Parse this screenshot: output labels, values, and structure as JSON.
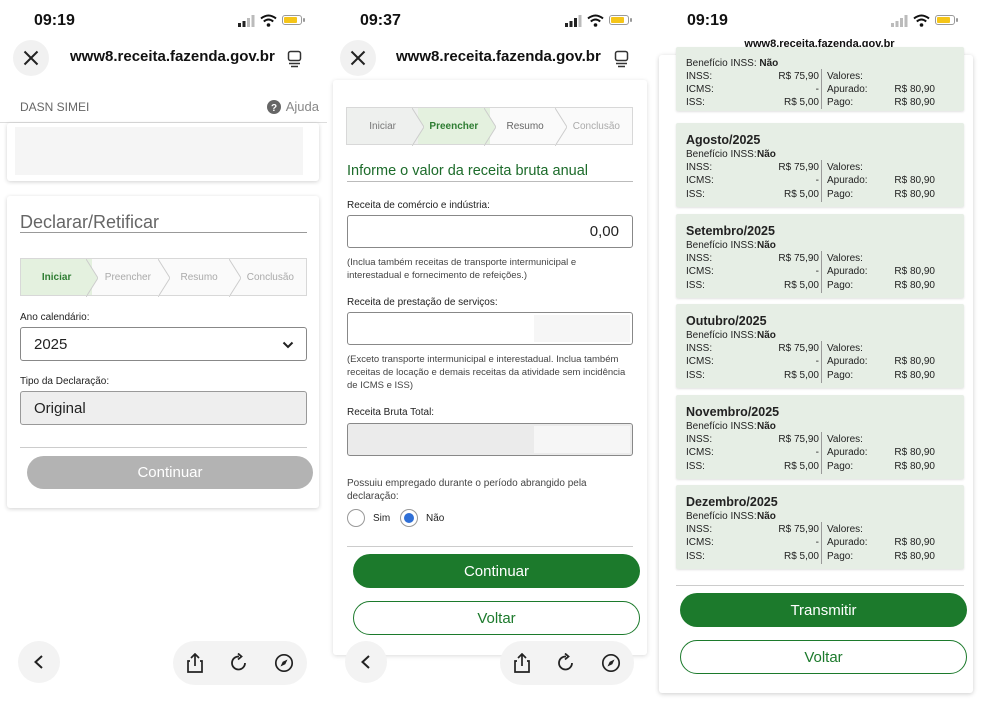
{
  "panel1": {
    "time": "09:19",
    "url": "www8.receita.fazenda.gov.br",
    "app_name": "DASN SIMEI",
    "help": "Ajuda",
    "title": "Declarar/Retificar",
    "steps": [
      "Iniciar",
      "Preencher",
      "Resumo",
      "Conclusão"
    ],
    "year_label": "Ano calendário:",
    "year_value": "2025",
    "type_label": "Tipo da Declaração:",
    "type_value": "Original",
    "continue": "Continuar"
  },
  "panel2": {
    "time": "09:37",
    "url": "www8.receita.fazenda.gov.br",
    "steps": [
      "Iniciar",
      "Preencher",
      "Resumo",
      "Conclusão"
    ],
    "heading": "Informe o valor da receita bruta anual",
    "commerce_label": "Receita de comércio e indústria:",
    "commerce_value": "0,00",
    "commerce_hint": "(Inclua também receitas de transporte intermunicipal e interestadual e fornecimento de refeições.)",
    "services_label": "Receita de prestação de serviços:",
    "services_value": "",
    "services_hint": "(Exceto transporte intermunicipal e interestadual. Inclua também receitas de locação e demais receitas da atividade sem incidência de ICMS e ISS)",
    "total_label": "Receita Bruta Total:",
    "employee_question": "Possuiu empregado durante o período abrangido pela declaração:",
    "option_yes": "Sim",
    "option_no": "Não",
    "selected_option": "Não",
    "continue": "Continuar",
    "back": "Voltar"
  },
  "panel3": {
    "time": "09:19",
    "url": "www8.receita.fazenda.gov.br",
    "partial": {
      "benefit_label": "Benefício INSS:",
      "benefit_value": "Não",
      "inss_label": "INSS:",
      "inss_value": "R$ 75,90",
      "icms_label": "ICMS:",
      "icms_value": "-",
      "iss_label": "ISS:",
      "iss_value": "R$ 5,00",
      "valores_label": "Valores:",
      "apurado_label": "Apurado:",
      "apurado_value": "R$ 80,90",
      "pago_label": "Pago:",
      "pago_value": "R$ 80,90"
    },
    "months": [
      {
        "month": "Agosto/2025",
        "benefit_label": "Benefício INSS:",
        "benefit_value": "Não",
        "inss_label": "INSS:",
        "inss_value": "R$ 75,90",
        "icms_label": "ICMS:",
        "icms_value": "-",
        "iss_label": "ISS:",
        "iss_value": "R$ 5,00",
        "valores_label": "Valores:",
        "apurado_label": "Apurado:",
        "apurado_value": "R$ 80,90",
        "pago_label": "Pago:",
        "pago_value": "R$ 80,90"
      },
      {
        "month": "Setembro/2025",
        "benefit_label": "Benefício INSS:",
        "benefit_value": "Não",
        "inss_label": "INSS:",
        "inss_value": "R$ 75,90",
        "icms_label": "ICMS:",
        "icms_value": "-",
        "iss_label": "ISS:",
        "iss_value": "R$ 5,00",
        "valores_label": "Valores:",
        "apurado_label": "Apurado:",
        "apurado_value": "R$ 80,90",
        "pago_label": "Pago:",
        "pago_value": "R$ 80,90"
      },
      {
        "month": "Outubro/2025",
        "benefit_label": "Benefício INSS:",
        "benefit_value": "Não",
        "inss_label": "INSS:",
        "inss_value": "R$ 75,90",
        "icms_label": "ICMS:",
        "icms_value": "-",
        "iss_label": "ISS:",
        "iss_value": "R$ 5,00",
        "valores_label": "Valores:",
        "apurado_label": "Apurado:",
        "apurado_value": "R$ 80,90",
        "pago_label": "Pago:",
        "pago_value": "R$ 80,90"
      },
      {
        "month": "Novembro/2025",
        "benefit_label": "Benefício INSS:",
        "benefit_value": "Não",
        "inss_label": "INSS:",
        "inss_value": "R$ 75,90",
        "icms_label": "ICMS:",
        "icms_value": "-",
        "iss_label": "ISS:",
        "iss_value": "R$ 5,00",
        "valores_label": "Valores:",
        "apurado_label": "Apurado:",
        "apurado_value": "R$ 80,90",
        "pago_label": "Pago:",
        "pago_value": "R$ 80,90"
      },
      {
        "month": "Dezembro/2025",
        "benefit_label": "Benefício INSS:",
        "benefit_value": "Não",
        "inss_label": "INSS:",
        "inss_value": "R$ 75,90",
        "icms_label": "ICMS:",
        "icms_value": "-",
        "iss_label": "ISS:",
        "iss_value": "R$ 5,00",
        "valores_label": "Valores:",
        "apurado_label": "Apurado:",
        "apurado_value": "R$ 80,90",
        "pago_label": "Pago:",
        "pago_value": "R$ 80,90"
      }
    ],
    "transmit": "Transmitir",
    "back": "Voltar"
  },
  "colors": {
    "primary_green": "#1c7a2c",
    "step_active_bg": "#e4f1df",
    "month_card_bg": "#e6eee5",
    "radio_selected": "#2f6fd6",
    "battery": "#f5c518"
  },
  "icons": [
    "close-icon",
    "tabs-icon",
    "help-icon",
    "chevron-down-icon",
    "back-arrow-icon",
    "share-icon",
    "reload-icon",
    "compass-icon",
    "signal-icon",
    "wifi-icon",
    "battery-icon"
  ]
}
